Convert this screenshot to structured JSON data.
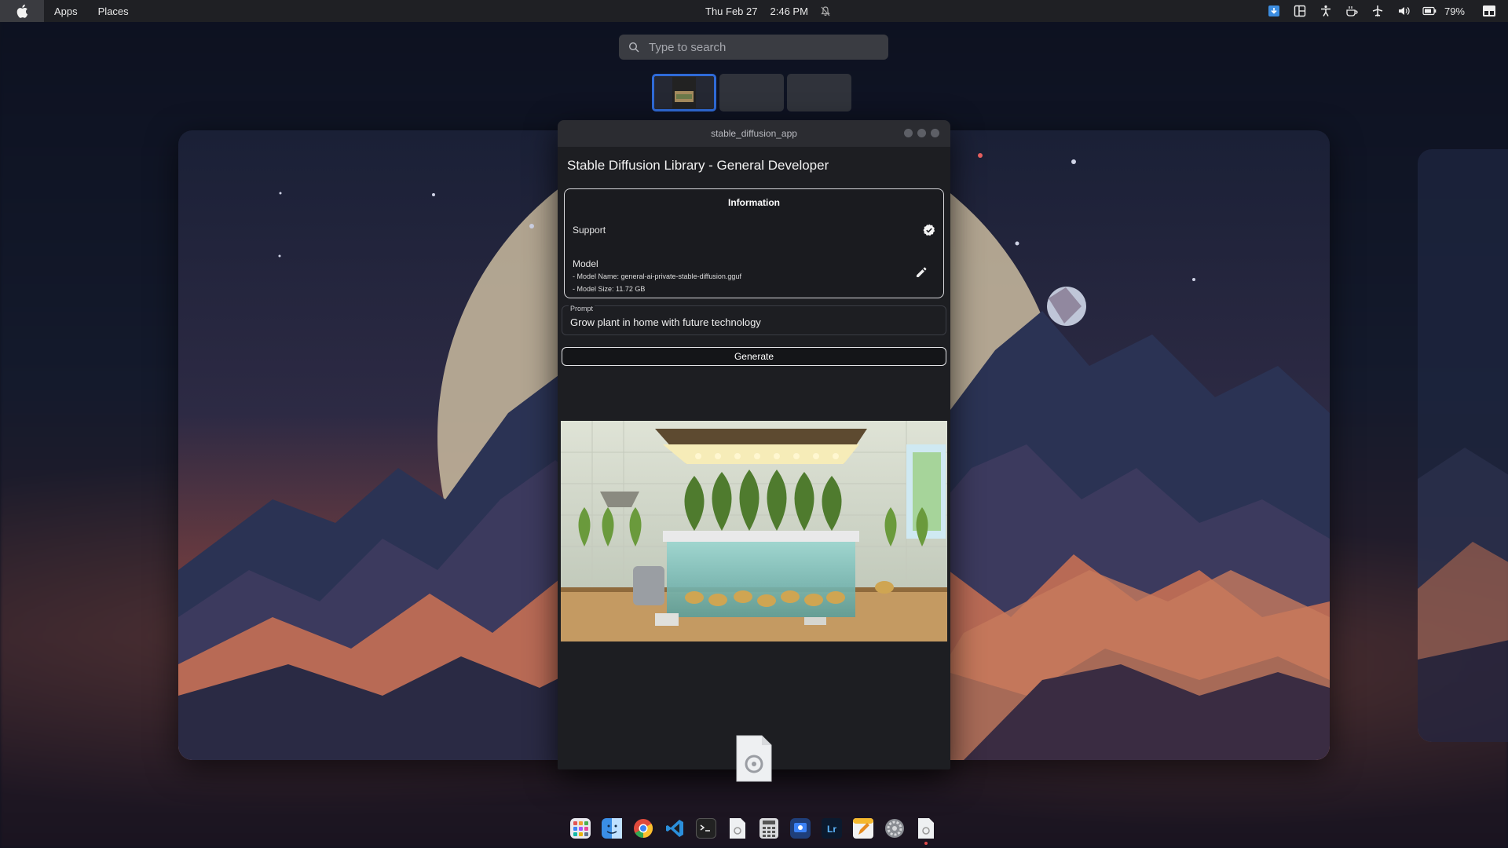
{
  "topbar": {
    "menu": [
      "Apps",
      "Places"
    ],
    "date": "Thu Feb 27",
    "time": "2:46 PM",
    "battery_percent": "79%",
    "tray_icons": [
      "download-icon",
      "layout-icon",
      "accessibility-icon",
      "coffee-icon",
      "airplane-icon",
      "volume-icon",
      "battery-icon"
    ]
  },
  "search": {
    "placeholder": "Type to search"
  },
  "window": {
    "title": "stable_diffusion_app",
    "heading": "Stable Diffusion Library - General Developer",
    "info": {
      "title": "Information",
      "support_label": "Support",
      "model_label": "Model",
      "model_name": "- Model Name: general-ai-private-stable-diffusion.gguf",
      "model_size": "- Model Size: 11.72 GB"
    },
    "prompt": {
      "label": "Prompt",
      "value": "Grow plant in home with future technology"
    },
    "generate_label": "Generate"
  },
  "dock": {
    "items": [
      "launchpad-icon",
      "finder-icon",
      "chrome-icon",
      "vscode-icon",
      "terminal-icon",
      "file-icon",
      "calculator-icon",
      "app-icon",
      "lightroom-icon",
      "notes-icon",
      "settings-icon",
      "file-icon-active"
    ],
    "lightroom_text": "Lr"
  },
  "colors": {
    "accent": "#2f6bd8",
    "topbar": "#1f2024",
    "window_bg": "#1d1e22"
  }
}
